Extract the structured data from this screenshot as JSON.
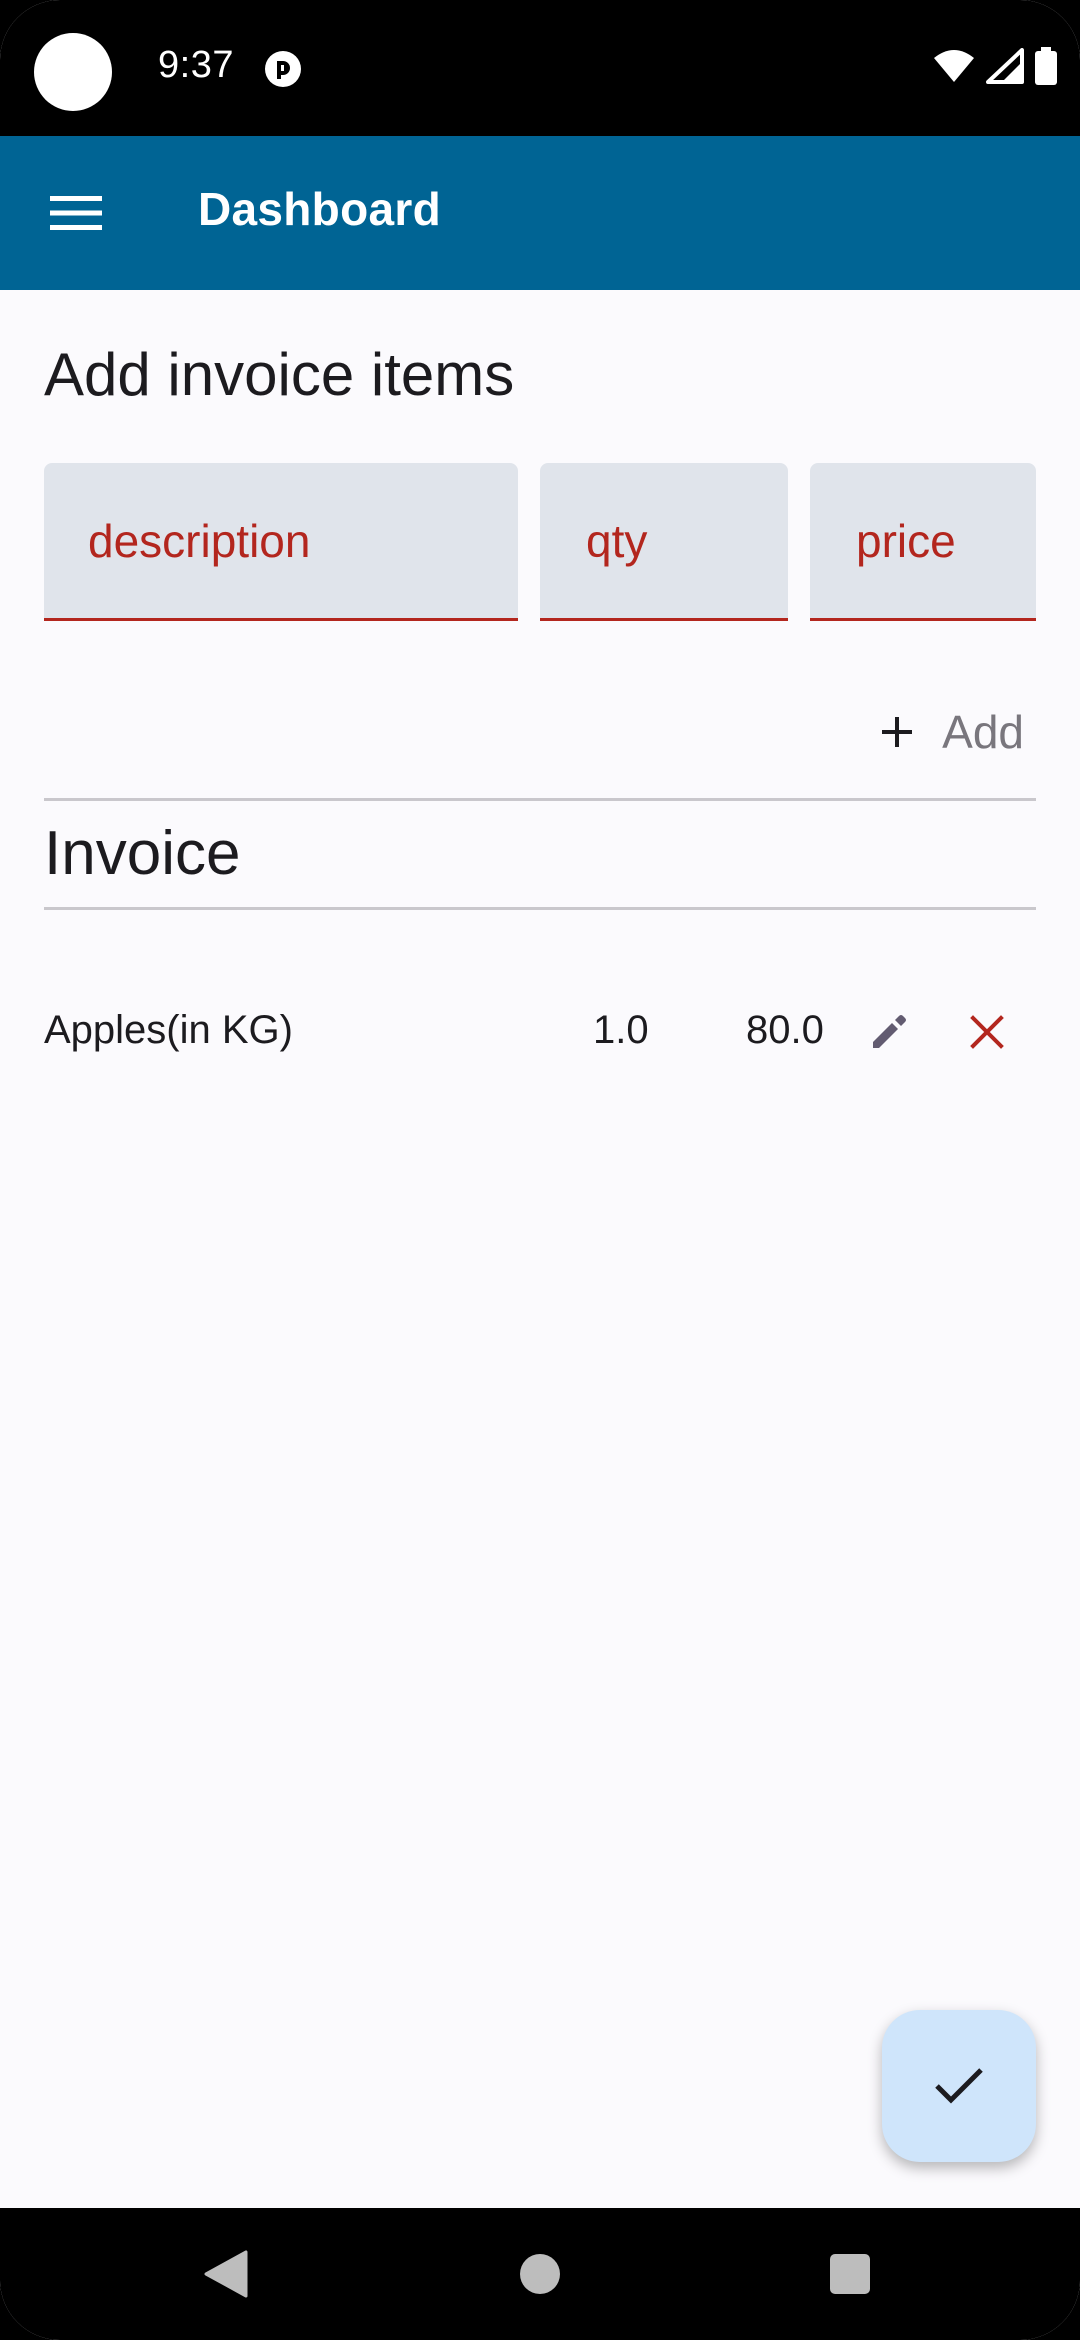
{
  "status_bar": {
    "time": "9:37"
  },
  "app_bar": {
    "title": "Dashboard",
    "menu_icon": "hamburger-menu-icon"
  },
  "add_section": {
    "title": "Add invoice items",
    "fields": {
      "description": {
        "value": "",
        "placeholder": "description"
      },
      "qty": {
        "value": "",
        "placeholder": "qty"
      },
      "price": {
        "value": "",
        "placeholder": "price"
      }
    },
    "add_button": {
      "icon": "plus-icon",
      "label": "Add"
    }
  },
  "invoice_section": {
    "title": "Invoice",
    "items": [
      {
        "description": "Apples(in KG)",
        "qty": "1.0",
        "price": "80.0"
      }
    ]
  },
  "fab": {
    "icon": "check-icon"
  },
  "colors": {
    "app_bar": "#006494",
    "error": "#b3261e",
    "field_fill": "#e0e4eb",
    "fab": "#cfe5fb",
    "edit_icon": "#625b71",
    "background": "#fbfafd"
  }
}
